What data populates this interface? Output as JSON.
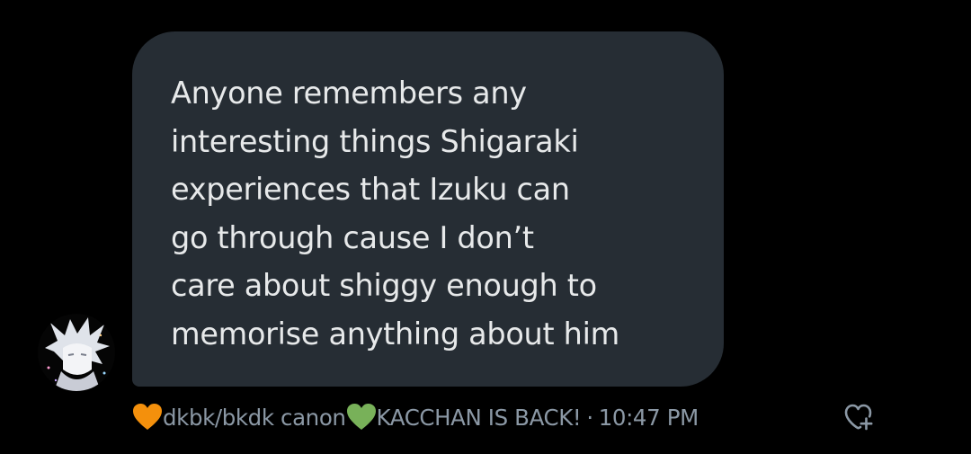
{
  "message": {
    "text": "Anyone remembers any\ninteresting things Shigaraki\nexperiences that Izuku can\ngo through cause I don’t\ncare about shiggy enough to\nmemorise anything about him"
  },
  "meta": {
    "sender_name_part1": "dkbk/bkdk canon",
    "sender_name_part2": " KACCHAN IS BACK!",
    "separator": "·",
    "time": "10:47 PM"
  },
  "icons": {
    "orange_heart": "orange-heart-emoji",
    "green_heart": "green-heart-emoji",
    "add_reaction": "heart-plus-icon"
  },
  "colors": {
    "background": "#000000",
    "bubble": "#262d34",
    "message_text": "#e7e9ea",
    "meta_text": "#8b98a5",
    "orange_heart": "#f4900c",
    "green_heart": "#78b159"
  }
}
